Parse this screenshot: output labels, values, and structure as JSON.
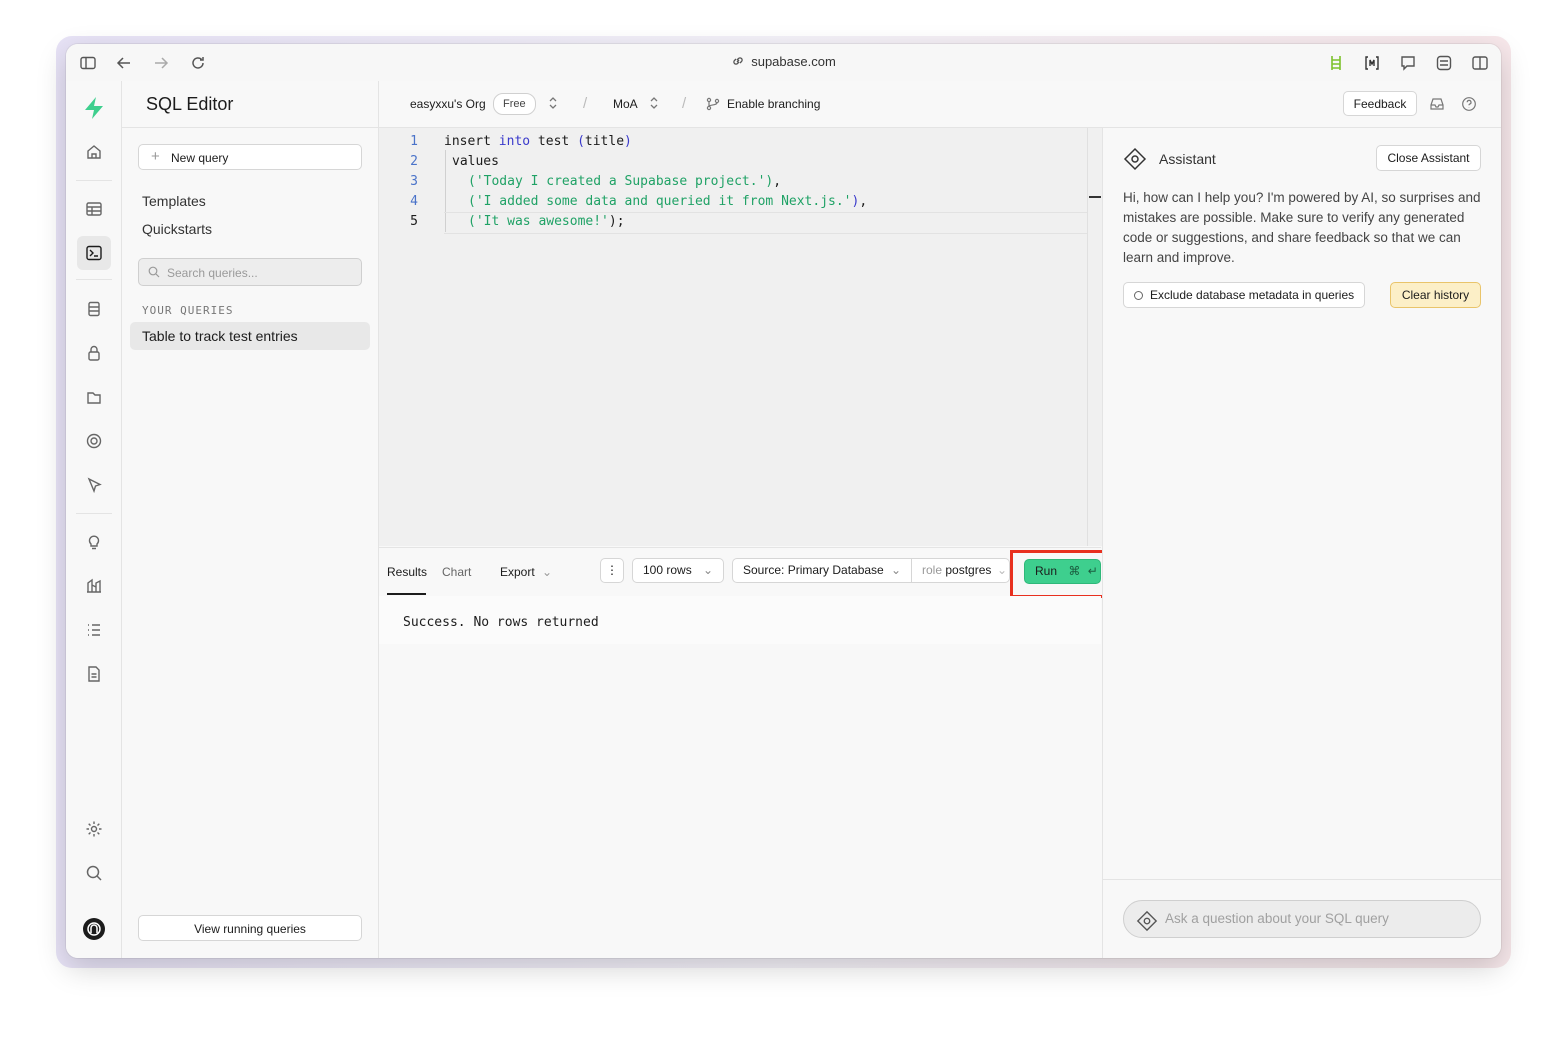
{
  "browser": {
    "url": "supabase.com",
    "icons": [
      "sidebar-toggle-icon",
      "back-arrow-icon",
      "forward-arrow-icon",
      "reload-icon",
      "link-icon",
      "extension-ladder-icon",
      "extension-bracket-icon",
      "extension-chat-icon",
      "extension-sliders-icon",
      "split-view-icon"
    ]
  },
  "rail": {
    "icons": [
      "supabase-logo-icon",
      "home-icon",
      "table-editor-icon",
      "sql-editor-icon",
      "database-icon",
      "auth-lock-icon",
      "storage-icon",
      "realtime-icon",
      "edge-functions-icon",
      "advisors-bulb-icon",
      "reports-chart-icon",
      "logs-list-icon",
      "api-docs-icon",
      "settings-gear-icon",
      "search-icon",
      "user-avatar-icon"
    ]
  },
  "sidebar": {
    "title": "SQL Editor",
    "new_query": "New query",
    "links": [
      "Templates",
      "Quickstarts"
    ],
    "search_placeholder": "Search queries...",
    "section_label": "YOUR QUERIES",
    "queries": [
      "Table to track test entries"
    ],
    "view_running": "View running queries"
  },
  "topbar": {
    "org": "easyxxu's Org",
    "plan": "Free",
    "project": "MoA",
    "branching": "Enable branching",
    "feedback": "Feedback"
  },
  "editor": {
    "line_numbers": [
      "1",
      "2",
      "3",
      "4",
      "5"
    ],
    "lines": [
      "insert into test (title)",
      "values",
      "('Today I created a Supabase project.'),",
      "('I added some data and queried it from Next.js.'),",
      "('It was awesome!');"
    ]
  },
  "results": {
    "tabs": [
      "Results",
      "Chart",
      "Export"
    ],
    "rows": "100 rows",
    "source": "Source: Primary Database",
    "role_label": "role",
    "role_value": "postgres",
    "run": "Run",
    "message": "Success. No rows returned"
  },
  "assistant": {
    "title": "Assistant",
    "close": "Close Assistant",
    "intro": "Hi, how can I help you? I'm powered by AI, so surprises and mistakes are possible. Make sure to verify any generated code or suggestions, and share feedback so that we can learn and improve.",
    "exclude": "Exclude database metadata in queries",
    "clear": "Clear history",
    "ask_placeholder": "Ask a question about your SQL query"
  },
  "colors": {
    "brand_green": "#3ecf8e",
    "highlight_red": "#e8301f",
    "clear_history_bg": "#fcefc7"
  }
}
